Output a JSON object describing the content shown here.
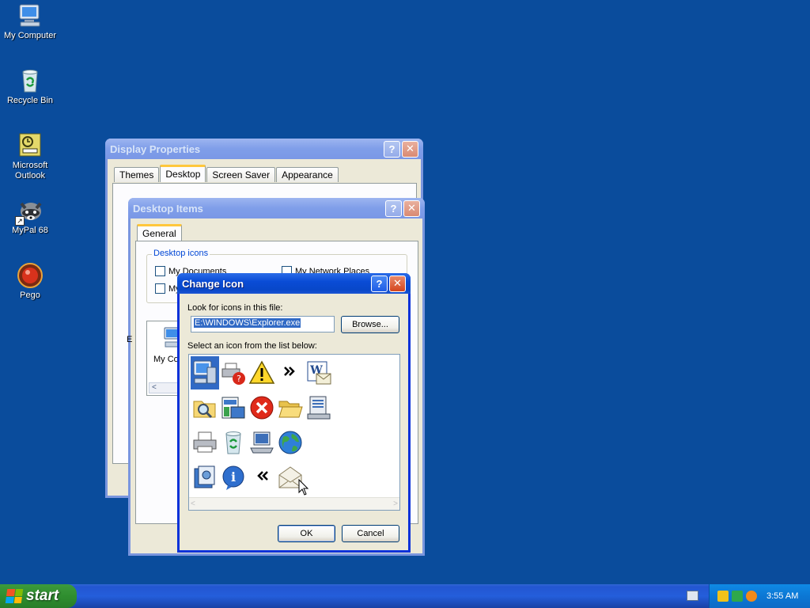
{
  "desktop": {
    "icons": [
      {
        "label": "My Computer",
        "icon": "my-computer-icon"
      },
      {
        "label": "Recycle Bin",
        "icon": "recycle-bin-icon"
      },
      {
        "label": "Microsoft Outlook",
        "icon": "outlook-icon"
      },
      {
        "label": "MyPal 68",
        "icon": "mypal-raccoon-icon"
      },
      {
        "label": "Pego",
        "icon": "pego-icon"
      }
    ]
  },
  "display_properties": {
    "title": "Display Properties",
    "tabs": [
      {
        "label": "Themes"
      },
      {
        "label": "Desktop",
        "selected": true
      },
      {
        "label": "Screen Saver"
      },
      {
        "label": "Appearance"
      }
    ]
  },
  "desktop_items": {
    "title": "Desktop Items",
    "tab": "General",
    "group_label": "Desktop icons",
    "checkboxes": [
      {
        "label": "My Documents",
        "checked": false
      },
      {
        "label": "My Network Places",
        "checked": false
      },
      {
        "label": "My",
        "checked": false
      }
    ],
    "preview_label": "My Co",
    "partial_label": "E"
  },
  "change_icon": {
    "title": "Change Icon",
    "look_label": "Look for icons in this file:",
    "file_path": "E:\\WINDOWS\\Explorer.exe",
    "browse_label": "Browse...",
    "select_label": "Select an icon from the list below:",
    "ok_label": "OK",
    "cancel_label": "Cancel",
    "selected_index": 0
  },
  "taskbar": {
    "start_label": "start",
    "clock": "3:55 AM"
  },
  "colors": {
    "desktop_bg": "#0a4c9c",
    "titlebar_active": "#0a4cd6",
    "selection": "#316ac5"
  }
}
